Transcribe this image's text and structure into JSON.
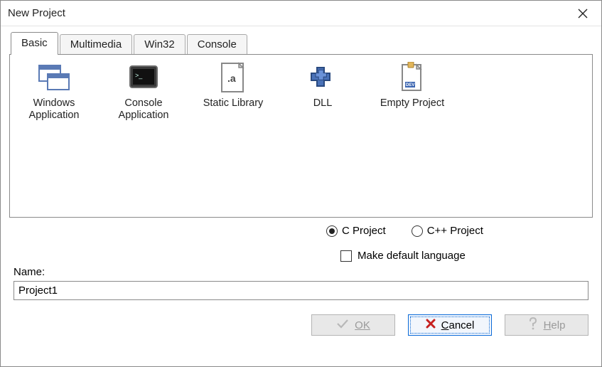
{
  "title": "New Project",
  "tabs": [
    "Basic",
    "Multimedia",
    "Win32",
    "Console"
  ],
  "active_tab": 0,
  "project_types": [
    {
      "name": "Windows Application",
      "icon": "windows-app-icon"
    },
    {
      "name": "Console Application",
      "icon": "console-app-icon"
    },
    {
      "name": "Static Library",
      "icon": "static-lib-icon"
    },
    {
      "name": "DLL",
      "icon": "dll-icon"
    },
    {
      "name": "Empty Project",
      "icon": "empty-project-icon"
    }
  ],
  "lang": {
    "c_label": "C Project",
    "cpp_label": "C++ Project",
    "selected": "c",
    "default_label": "Make default language",
    "default_checked": false
  },
  "name_label": "Name:",
  "name_value": "Project1",
  "buttons": {
    "ok": "OK",
    "cancel": "Cancel",
    "help": "Help"
  }
}
